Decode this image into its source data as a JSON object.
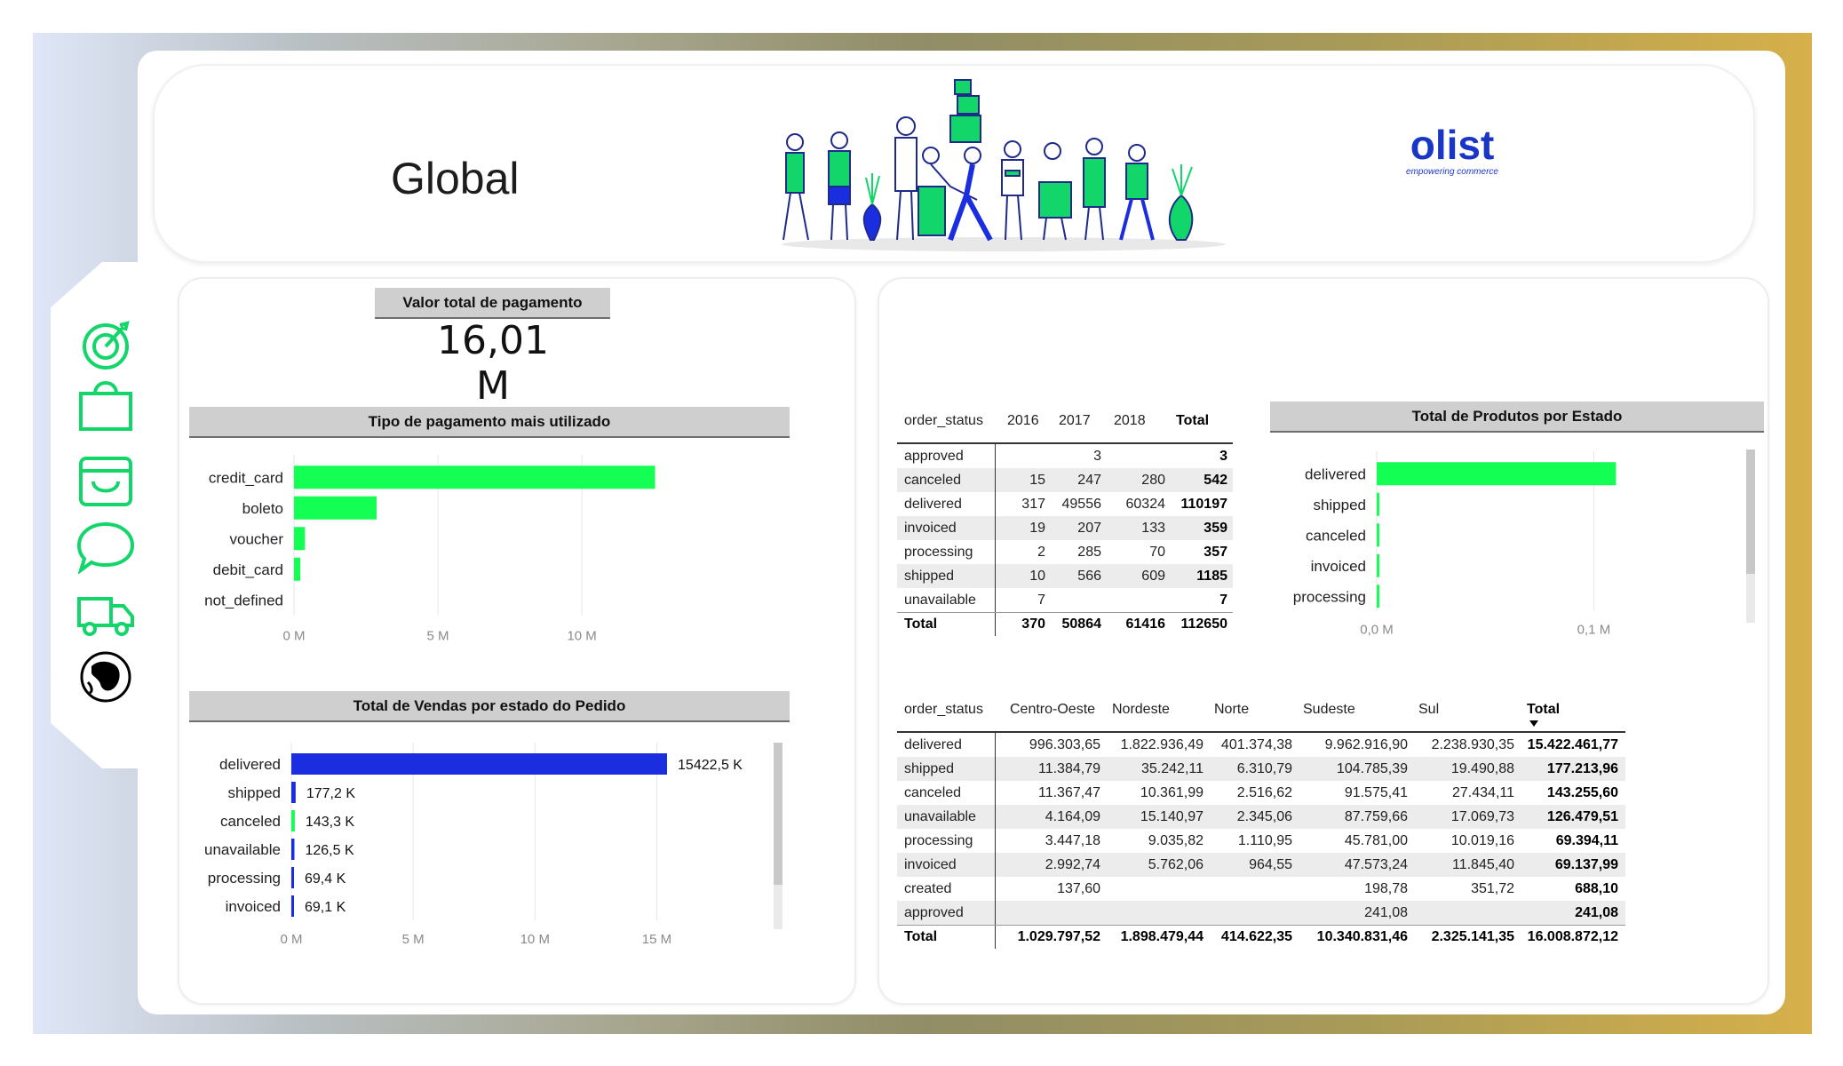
{
  "header": {
    "title": "Global",
    "logo_name": "olist",
    "logo_tagline": "empowering commerce"
  },
  "nav": [
    {
      "icon": "target-icon"
    },
    {
      "icon": "shopping-bag-icon"
    },
    {
      "icon": "storefront-icon"
    },
    {
      "icon": "chat-bubble-icon"
    },
    {
      "icon": "delivery-truck-icon"
    },
    {
      "icon": "globe-icon"
    }
  ],
  "kpi": {
    "label": "Valor total de pagamento",
    "value": "16,01 M"
  },
  "colors": {
    "green": "#13ff54",
    "blue": "#1a2ee0",
    "banner_bg": "#cfcfcf"
  },
  "chart_data": [
    {
      "type": "bar",
      "orientation": "horizontal",
      "title": "Tipo de pagamento mais utilizado",
      "categories": [
        "credit_card",
        "boleto",
        "voucher",
        "debit_card",
        "not_defined"
      ],
      "values": [
        12.54,
        2.87,
        0.38,
        0.22,
        0.0
      ],
      "xlim": [
        0,
        14.5
      ],
      "ticks": [
        {
          "v": 0,
          "label": "0 M"
        },
        {
          "v": 5,
          "label": "5 M"
        },
        {
          "v": 10,
          "label": "10 M"
        }
      ],
      "color": "#13ff54",
      "grid": true
    },
    {
      "type": "bar",
      "orientation": "horizontal",
      "title": "Total de Vendas por estado do Pedido",
      "categories": [
        "delivered",
        "shipped",
        "canceled",
        "unavailable",
        "processing",
        "invoiced"
      ],
      "values": [
        15422.5,
        177.2,
        143.3,
        126.5,
        69.4,
        69.1
      ],
      "data_labels": [
        "15422,5 K",
        "177,2 K",
        "143,3 K",
        "126,5 K",
        "69,4 K",
        "69,1 K"
      ],
      "bar_colors": [
        "#1a2ee0",
        "#1a2ee0",
        "#13ff54",
        "#1a2ee0",
        "#1a2ee0",
        "#1a2ee0"
      ],
      "xlim": [
        0,
        17500
      ],
      "ticks": [
        {
          "v": 0,
          "label": "0 M"
        },
        {
          "v": 5000,
          "label": "5 M"
        },
        {
          "v": 10000,
          "label": "10 M"
        },
        {
          "v": 15000,
          "label": "15 M"
        }
      ],
      "grid": true
    },
    {
      "type": "bar",
      "orientation": "horizontal",
      "title": "Total de Produtos por Estado",
      "categories": [
        "delivered",
        "shipped",
        "canceled",
        "invoiced",
        "processing"
      ],
      "values": [
        0.110197,
        0.001185,
        0.000542,
        0.000359,
        0.000357
      ],
      "xlim": [
        0,
        0.135
      ],
      "ticks": [
        {
          "v": 0,
          "label": "0,0 M"
        },
        {
          "v": 0.1,
          "label": "0,1 M"
        }
      ],
      "color": "#13ff54",
      "grid": true
    }
  ],
  "table_years": {
    "headers": [
      "order_status",
      "2016",
      "2017",
      "2018",
      "Total"
    ],
    "rows": [
      [
        "approved",
        "",
        "3",
        "",
        "3"
      ],
      [
        "canceled",
        "15",
        "247",
        "280",
        "542"
      ],
      [
        "delivered",
        "317",
        "49556",
        "60324",
        "110197"
      ],
      [
        "invoiced",
        "19",
        "207",
        "133",
        "359"
      ],
      [
        "processing",
        "2",
        "285",
        "70",
        "357"
      ],
      [
        "shipped",
        "10",
        "566",
        "609",
        "1185"
      ],
      [
        "unavailable",
        "7",
        "",
        "",
        "7"
      ]
    ],
    "total": [
      "Total",
      "370",
      "50864",
      "61416",
      "112650"
    ]
  },
  "table_regions": {
    "headers": [
      "order_status",
      "Centro-Oeste",
      "Nordeste",
      "Norte",
      "Sudeste",
      "Sul",
      "Total"
    ],
    "rows": [
      [
        "delivered",
        "996.303,65",
        "1.822.936,49",
        "401.374,38",
        "9.962.916,90",
        "2.238.930,35",
        "15.422.461,77"
      ],
      [
        "shipped",
        "11.384,79",
        "35.242,11",
        "6.310,79",
        "104.785,39",
        "19.490,88",
        "177.213,96"
      ],
      [
        "canceled",
        "11.367,47",
        "10.361,99",
        "2.516,62",
        "91.575,41",
        "27.434,11",
        "143.255,60"
      ],
      [
        "unavailable",
        "4.164,09",
        "15.140,97",
        "2.345,06",
        "87.759,66",
        "17.069,73",
        "126.479,51"
      ],
      [
        "processing",
        "3.447,18",
        "9.035,82",
        "1.110,95",
        "45.781,00",
        "10.019,16",
        "69.394,11"
      ],
      [
        "invoiced",
        "2.992,74",
        "5.762,06",
        "964,55",
        "47.573,24",
        "11.845,40",
        "69.137,99"
      ],
      [
        "created",
        "137,60",
        "",
        "",
        "198,78",
        "351,72",
        "688,10"
      ],
      [
        "approved",
        "",
        "",
        "",
        "241,08",
        "",
        "241,08"
      ]
    ],
    "total": [
      "Total",
      "1.029.797,52",
      "1.898.479,44",
      "414.622,35",
      "10.340.831,46",
      "2.325.141,35",
      "16.008.872,12"
    ]
  }
}
